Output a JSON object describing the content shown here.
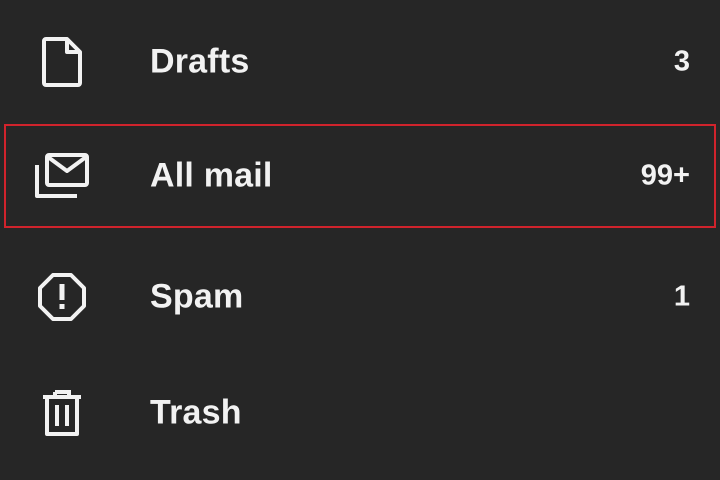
{
  "nav": {
    "items": [
      {
        "label": "Drafts",
        "count": "3",
        "icon": "draft-file-icon"
      },
      {
        "label": "All mail",
        "count": "99+",
        "icon": "all-mail-icon"
      },
      {
        "label": "Spam",
        "count": "1",
        "icon": "spam-octagon-icon"
      },
      {
        "label": "Trash",
        "count": "",
        "icon": "trash-icon"
      }
    ],
    "highlight_color": "#d0232c",
    "background_color": "#262626",
    "text_color": "#f2f2f2"
  }
}
